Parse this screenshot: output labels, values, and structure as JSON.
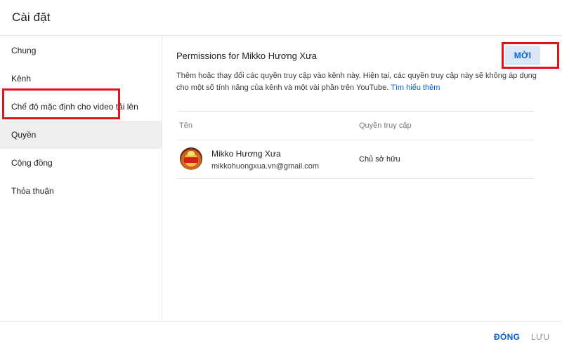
{
  "dialog": {
    "title": "Cài đặt"
  },
  "sidebar": {
    "items": [
      {
        "label": "Chung"
      },
      {
        "label": "Kênh"
      },
      {
        "label": "Chế độ mặc định cho video tải lên"
      },
      {
        "label": "Quyền",
        "active": true
      },
      {
        "label": "Cộng đồng"
      },
      {
        "label": "Thỏa thuận"
      }
    ]
  },
  "permissions": {
    "title": "Permissions for Mikko Hương Xưa",
    "invite_label": "MỜI",
    "description": "Thêm hoặc thay đổi các quyền truy cập vào kênh này. Hiện tại, các quyền truy cập này sẽ không áp dụng cho một số tính năng của kênh và một vài phần trên YouTube.",
    "learn_more": "Tìm hiểu thêm",
    "columns": {
      "name": "Tên",
      "access": "Quyền truy cập"
    },
    "users": [
      {
        "name": "Mikko Hương Xưa",
        "email": "mikkohuongxua.vn@gmail.com",
        "role": "Chủ sở hữu"
      }
    ]
  },
  "footer": {
    "close_label": "ĐÓNG",
    "save_label": "LƯU"
  },
  "colors": {
    "accent": "#065fd4",
    "highlight": "#e0141b",
    "active_bg": "#eeeeee",
    "invite_bg": "#dbe7f7"
  }
}
